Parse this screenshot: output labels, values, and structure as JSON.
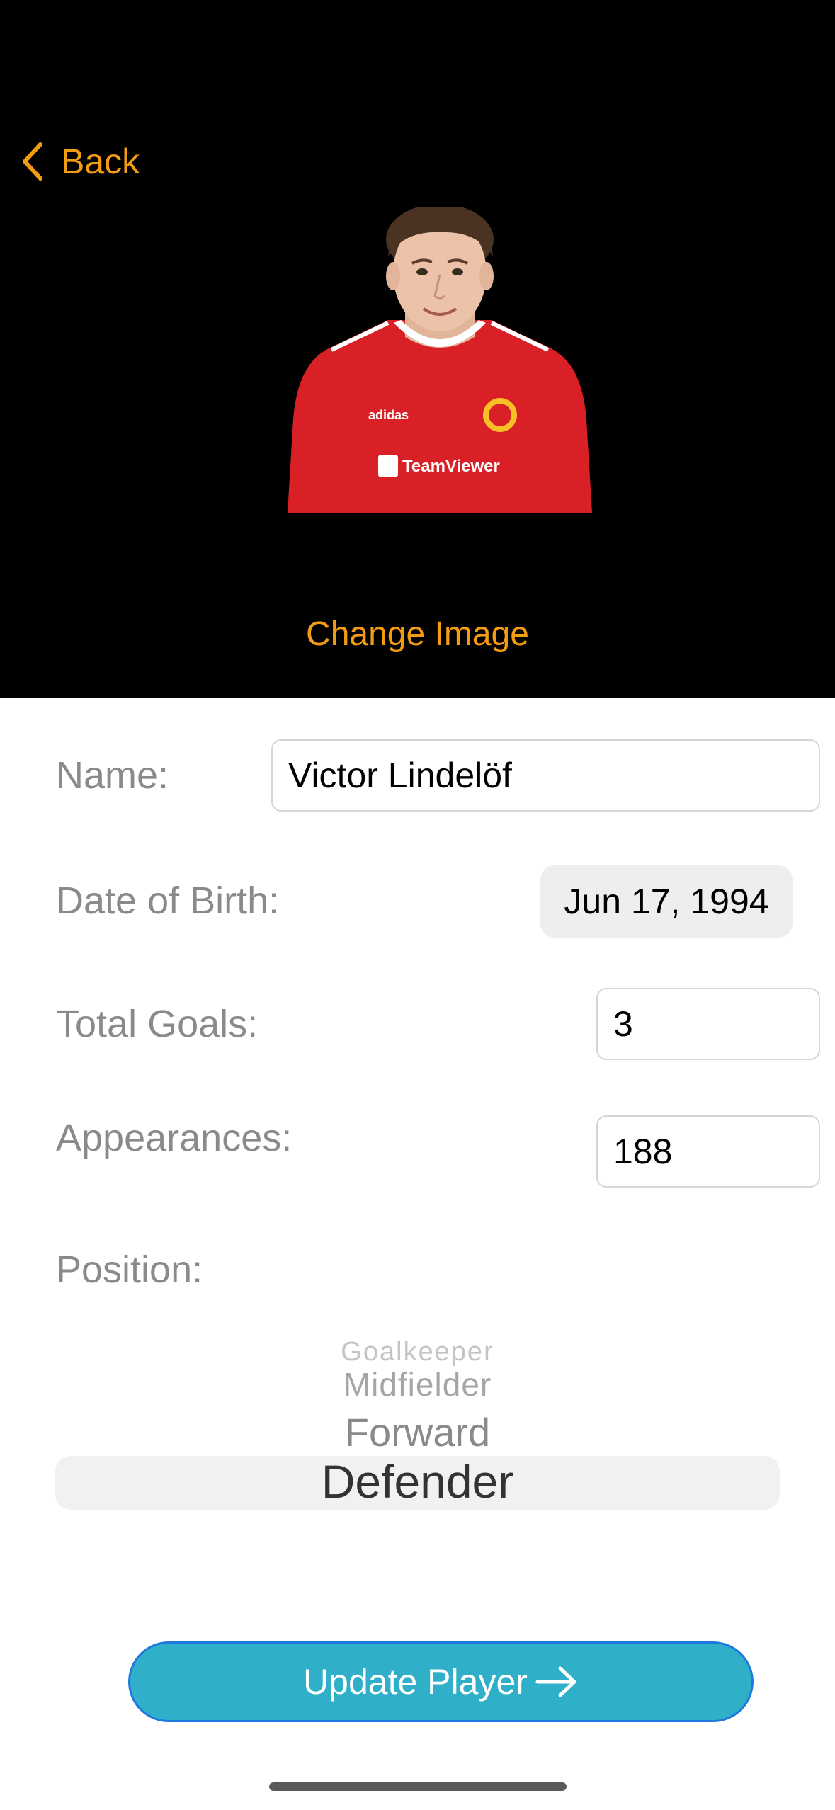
{
  "nav": {
    "back_label": "Back"
  },
  "header": {
    "change_image_label": "Change Image"
  },
  "form": {
    "name_label": "Name:",
    "name_value": "Victor Lindelöf",
    "dob_label": "Date of Birth:",
    "dob_value": "Jun 17, 1994",
    "goals_label": "Total Goals:",
    "goals_value": "3",
    "appearances_label": "Appearances:",
    "appearances_value": "188",
    "position_label": "Position:"
  },
  "position_picker": {
    "options": [
      "Goalkeeper",
      "Midfielder",
      "Forward",
      "Defender"
    ],
    "selected": "Defender"
  },
  "actions": {
    "update_label": "Update Player"
  },
  "colors": {
    "accent": "#F39C12",
    "button_fill": "#30afc8",
    "button_border": "#1e78e0",
    "header_bg": "#000000"
  },
  "icons": {
    "back": "chevron-left-icon",
    "update": "arrow-right-icon"
  }
}
